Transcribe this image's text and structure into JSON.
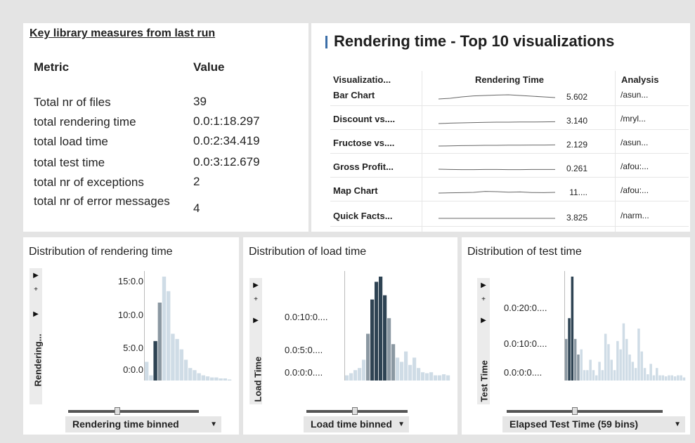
{
  "kpi": {
    "title": "Key library measures from last run",
    "headers": {
      "metric": "Metric",
      "value": "Value"
    },
    "rows": [
      {
        "label": "Total nr of files",
        "value": "39"
      },
      {
        "label": "total rendering time",
        "value": "0.0:1:18.297"
      },
      {
        "label": "total load time",
        "value": "0.0:2:34.419"
      },
      {
        "label": "total test time",
        "value": "0.0:3:12.679"
      },
      {
        "label": "total nr of exceptions",
        "value": "2"
      },
      {
        "label": "total nr of error messages",
        "value": "4"
      }
    ]
  },
  "top10": {
    "title": "Rendering time - Top 10 visualizations",
    "columns": {
      "viz": "Visualizatio...",
      "rendering": "Rendering Time",
      "analysis": "Analysis"
    },
    "rows": [
      {
        "name": "Bar Chart",
        "value": "5.602",
        "path": "/asun...",
        "spark": [
          0.3,
          0.35,
          0.45,
          0.52,
          0.55,
          0.58,
          0.6,
          0.55,
          0.5,
          0.45,
          0.4
        ]
      },
      {
        "name": "Discount vs....",
        "value": "3.140",
        "path": "/mryl...",
        "spark": [
          0.25,
          0.28,
          0.3,
          0.32,
          0.34,
          0.35,
          0.35,
          0.36,
          0.36,
          0.37,
          0.38
        ]
      },
      {
        "name": "Fructose vs....",
        "value": "2.129",
        "path": "/asun...",
        "spark": [
          0.35,
          0.36,
          0.38,
          0.39,
          0.4,
          0.4,
          0.41,
          0.41,
          0.42,
          0.42,
          0.43
        ]
      },
      {
        "name": "Gross Profit...",
        "value": "0.261",
        "path": "/afou:...",
        "spark": [
          0.4,
          0.38,
          0.37,
          0.37,
          0.38,
          0.38,
          0.37,
          0.37,
          0.38,
          0.38,
          0.38
        ]
      },
      {
        "name": "Map Chart",
        "value": "11....",
        "path": "/afou:...",
        "spark": [
          0.4,
          0.42,
          0.43,
          0.45,
          0.52,
          0.5,
          0.46,
          0.48,
          0.44,
          0.43,
          0.45
        ]
      },
      {
        "name": "Quick Facts...",
        "value": "3.825",
        "path": "/narm...",
        "spark": [
          0.4,
          0.4,
          0.4,
          0.4,
          0.4,
          0.4,
          0.4,
          0.4,
          0.4,
          0.4,
          0.4
        ]
      }
    ]
  },
  "distributions": [
    {
      "title": "Distribution of rendering time",
      "axis_title": "Rendering...",
      "ticks": [
        "15:0.0",
        "10:0.0",
        "5:0.0",
        "0:0.0"
      ],
      "dropdown": "Rendering time binned",
      "bars": [
        0.18,
        0.05,
        0.38,
        0.75,
        1.0,
        0.86,
        0.45,
        0.4,
        0.3,
        0.2,
        0.12,
        0.1,
        0.07,
        0.05,
        0.04,
        0.03,
        0.03,
        0.02,
        0.02,
        0.01
      ],
      "dark": [
        2
      ],
      "mid": [
        3
      ]
    },
    {
      "title": "Distribution of load time",
      "axis_title": "Load Time",
      "ticks": [
        "0.0:10:0....",
        "0.0:5:0....",
        "0.0:0:0...."
      ],
      "dropdown": "Load time binned",
      "bars": [
        0.05,
        0.07,
        0.1,
        0.12,
        0.2,
        0.45,
        0.78,
        0.95,
        1.0,
        0.82,
        0.6,
        0.35,
        0.22,
        0.18,
        0.28,
        0.15,
        0.22,
        0.12,
        0.08,
        0.07,
        0.08,
        0.05,
        0.05,
        0.06,
        0.05
      ],
      "dark": [
        6,
        7,
        8,
        9
      ],
      "mid": [
        5,
        10,
        11
      ]
    },
    {
      "title": "Distribution of test time",
      "axis_title": "Test Time",
      "ticks": [
        "0.0:20:0....",
        "0.0:10:0....",
        "0.0:0:0...."
      ],
      "dropdown": "Elapsed Test Time (59 bins)",
      "bars": [
        0.4,
        0.6,
        1.0,
        0.4,
        0.25,
        0.3,
        0.1,
        0.1,
        0.2,
        0.1,
        0.05,
        0.18,
        0.1,
        0.45,
        0.35,
        0.2,
        0.1,
        0.38,
        0.3,
        0.55,
        0.4,
        0.25,
        0.18,
        0.12,
        0.5,
        0.28,
        0.12,
        0.06,
        0.16,
        0.05,
        0.12,
        0.05,
        0.05,
        0.04,
        0.05,
        0.05,
        0.04,
        0.05,
        0.05,
        0.03
      ],
      "dark": [
        1,
        2
      ],
      "mid": [
        0,
        3,
        4
      ]
    }
  ]
}
